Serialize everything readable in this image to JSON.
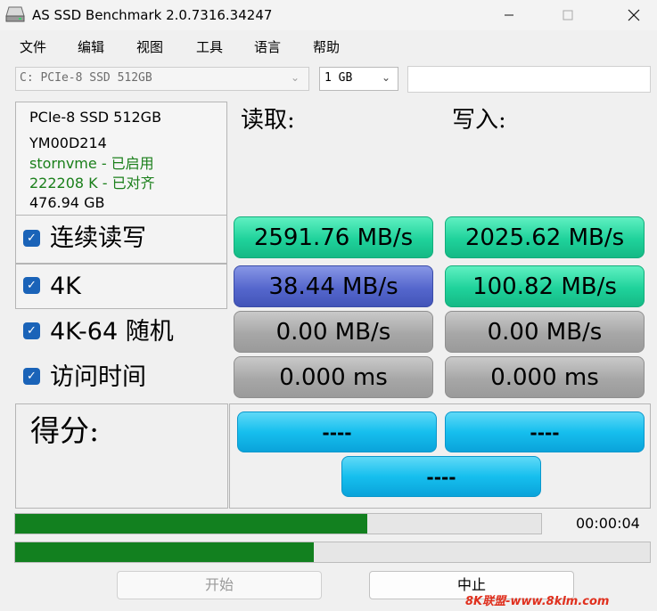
{
  "window": {
    "title": "AS SSD Benchmark 2.0.7316.34247",
    "icon": "ssd-drive-icon"
  },
  "menu": [
    "文件",
    "编辑",
    "视图",
    "工具",
    "语言",
    "帮助"
  ],
  "drive_select": {
    "value": "C: PCIe-8 SSD 512GB"
  },
  "size_select": {
    "value": "1 GB"
  },
  "drive_info": {
    "model": "PCIe-8 SSD 512GB",
    "firmware": "YM00D214",
    "driver": "stornvme - 已启用",
    "alignment": "222208 K - 已对齐",
    "capacity": "476.94 GB",
    "status_color": "#1a7f1a"
  },
  "headers": {
    "read": "读取:",
    "write": "写入:"
  },
  "rows": [
    {
      "label": "连续读写",
      "checked": true,
      "read": "2591.76 MB/s",
      "write": "2025.62 MB/s"
    },
    {
      "label": "4K",
      "checked": true,
      "read": "38.44 MB/s",
      "write": "100.82 MB/s"
    },
    {
      "label": "4K-64 随机",
      "checked": true,
      "read": "0.00 MB/s",
      "write": "0.00 MB/s"
    },
    {
      "label": "访问时间",
      "checked": true,
      "read": "0.000 ms",
      "write": "0.000 ms"
    }
  ],
  "score": {
    "label": "得分:",
    "read": "----",
    "write": "----",
    "total": "----"
  },
  "progress": {
    "current_fraction": 0.67,
    "overall_fraction": 0.47,
    "elapsed": "00:00:04"
  },
  "buttons": {
    "start": "开始",
    "abort": "中止"
  },
  "watermark": "8K联盟-www.8klm.com",
  "colors": {
    "green_cell": "#1fd29b",
    "blue_cell": "#5567cd",
    "gray_cell": "#a7a7a7",
    "score_cell": "#16bfee",
    "progress": "#12801f"
  }
}
